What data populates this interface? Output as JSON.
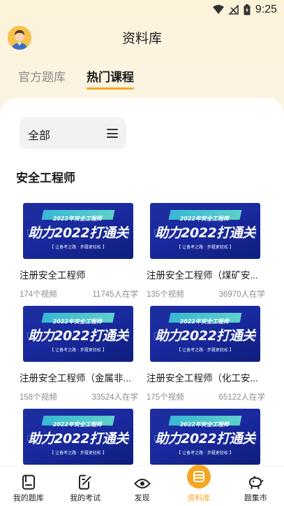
{
  "status_bar": {
    "time": "9:25"
  },
  "header": {
    "title": "资料库"
  },
  "tabs": [
    {
      "label": "官方题库",
      "active": false
    },
    {
      "label": "热门课程",
      "active": true
    }
  ],
  "filter": {
    "label": "全部"
  },
  "section": {
    "title": "安全工程师"
  },
  "thumbnail": {
    "badge": "2022年安全工程师",
    "headline": "助力2022打通关",
    "tagline": "【 让备考之路 · 步履更轻松 】"
  },
  "courses": [
    {
      "name": "注册安全工程师",
      "videos": "174个视频",
      "learners": "11745人在学"
    },
    {
      "name": "注册安全工程师（煤矿安...",
      "videos": "135个视频",
      "learners": "36970人在学"
    },
    {
      "name": "注册安全工程师（金属非...",
      "videos": "158个视频",
      "learners": "33524人在学"
    },
    {
      "name": "注册安全工程师（化工安...",
      "videos": "175个视频",
      "learners": "65122人在学"
    }
  ],
  "bottom_nav": [
    {
      "label": "我的题库",
      "icon": "book-icon",
      "active": false
    },
    {
      "label": "我的考试",
      "icon": "edit-note-icon",
      "active": false
    },
    {
      "label": "发现",
      "icon": "eye-icon",
      "active": false
    },
    {
      "label": "资料库",
      "icon": "library-icon",
      "active": true
    },
    {
      "label": "题集市",
      "icon": "piggy-bank-icon",
      "active": false
    }
  ],
  "colors": {
    "accent": "#f5a623",
    "thumbnail_bg": "#1a2aa0"
  }
}
